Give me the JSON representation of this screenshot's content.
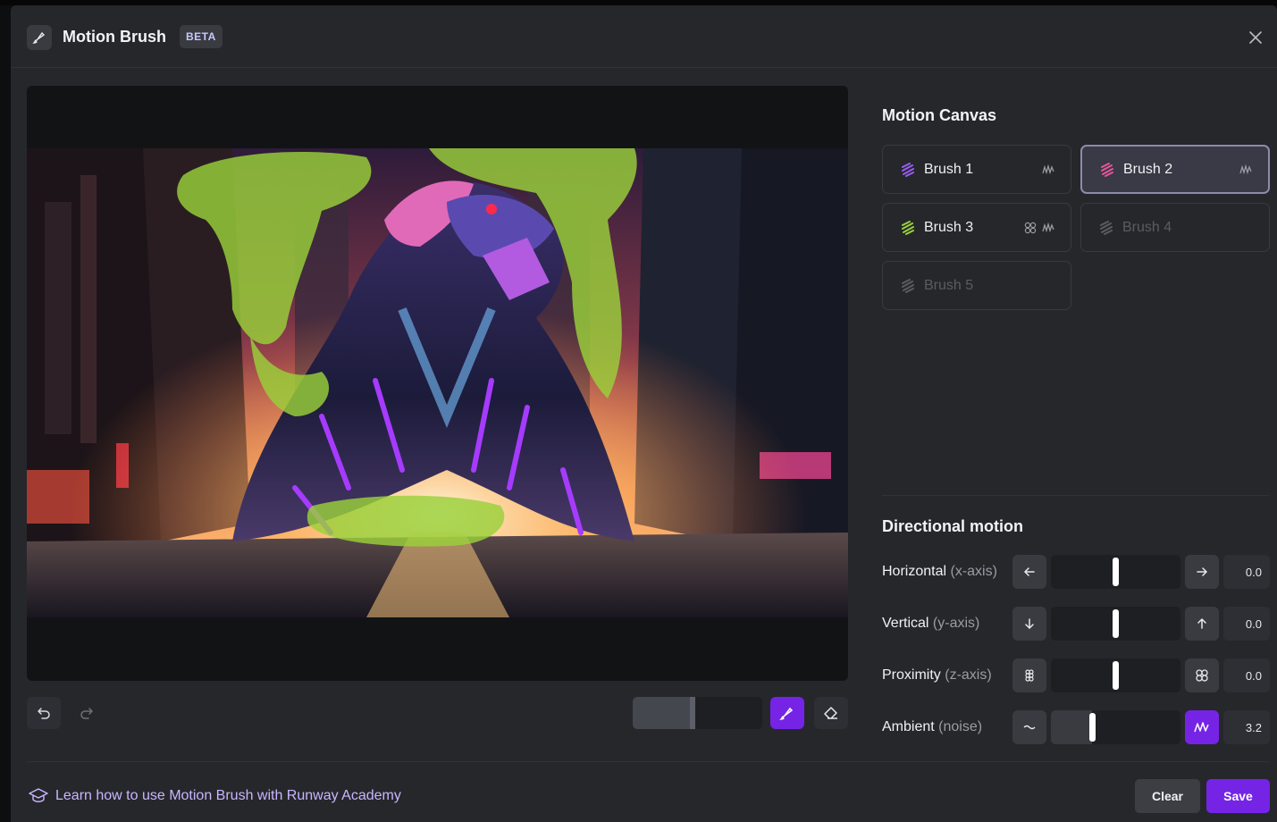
{
  "header": {
    "title": "Motion Brush",
    "badge": "BETA"
  },
  "canvas": {
    "image_description_icon": "tiger-image"
  },
  "tools": {
    "undo_icon": "undo-icon",
    "redo_icon": "redo-icon",
    "brush_size_fraction": 0.46,
    "brush_icon": "brush-icon",
    "eraser_icon": "eraser-icon"
  },
  "motion_canvas": {
    "title": "Motion Canvas",
    "brushes": [
      {
        "label": "Brush 1",
        "color": "#9b5cf6",
        "state": "default",
        "icons": [
          "wave"
        ]
      },
      {
        "label": "Brush 2",
        "color": "#e8559c",
        "state": "active",
        "icons": [
          "wave"
        ]
      },
      {
        "label": "Brush 3",
        "color": "#9ad13a",
        "state": "default",
        "icons": [
          "proximity",
          "wave"
        ]
      },
      {
        "label": "Brush 4",
        "color": "#5b5c63",
        "state": "disabled",
        "icons": []
      },
      {
        "label": "Brush 5",
        "color": "#5b5c63",
        "state": "disabled",
        "icons": []
      }
    ]
  },
  "directional": {
    "title": "Directional motion",
    "rows": [
      {
        "label": "Horizontal",
        "sub": "(x-axis)",
        "value": "0.0",
        "level": 0.5
      },
      {
        "label": "Vertical",
        "sub": "(y-axis)",
        "value": "0.0",
        "level": 0.5
      },
      {
        "label": "Proximity",
        "sub": "(z-axis)",
        "value": "0.0",
        "level": 0.5
      },
      {
        "label": "Ambient",
        "sub": "(noise)",
        "value": "3.2",
        "level": 0.32
      }
    ]
  },
  "footer": {
    "learn_link": "Learn how to use Motion Brush with Runway Academy",
    "clear_label": "Clear",
    "save_label": "Save"
  },
  "colors": {
    "accent": "#7524e6",
    "motion_paint": "#9ad13a"
  }
}
